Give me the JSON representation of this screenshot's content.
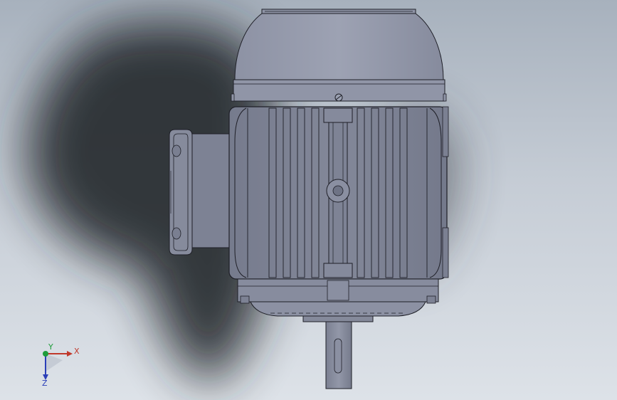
{
  "viewport": {
    "background_top": "#a7b1bd",
    "background_bottom": "#dde2e8",
    "model_color": "#7f8496",
    "model_edge_color": "#1e1f27",
    "shadow_color": "#22262c"
  },
  "model": {
    "name": "electric-motor",
    "parts": [
      "fan-cover",
      "stator-housing",
      "terminal-box",
      "end-shield",
      "shaft"
    ]
  },
  "triad": {
    "x_label": "X",
    "y_label": "Y",
    "z_label": "Z",
    "x_color": "#c0392b",
    "y_color": "#1e9c3a",
    "z_color": "#2b3fb8"
  }
}
